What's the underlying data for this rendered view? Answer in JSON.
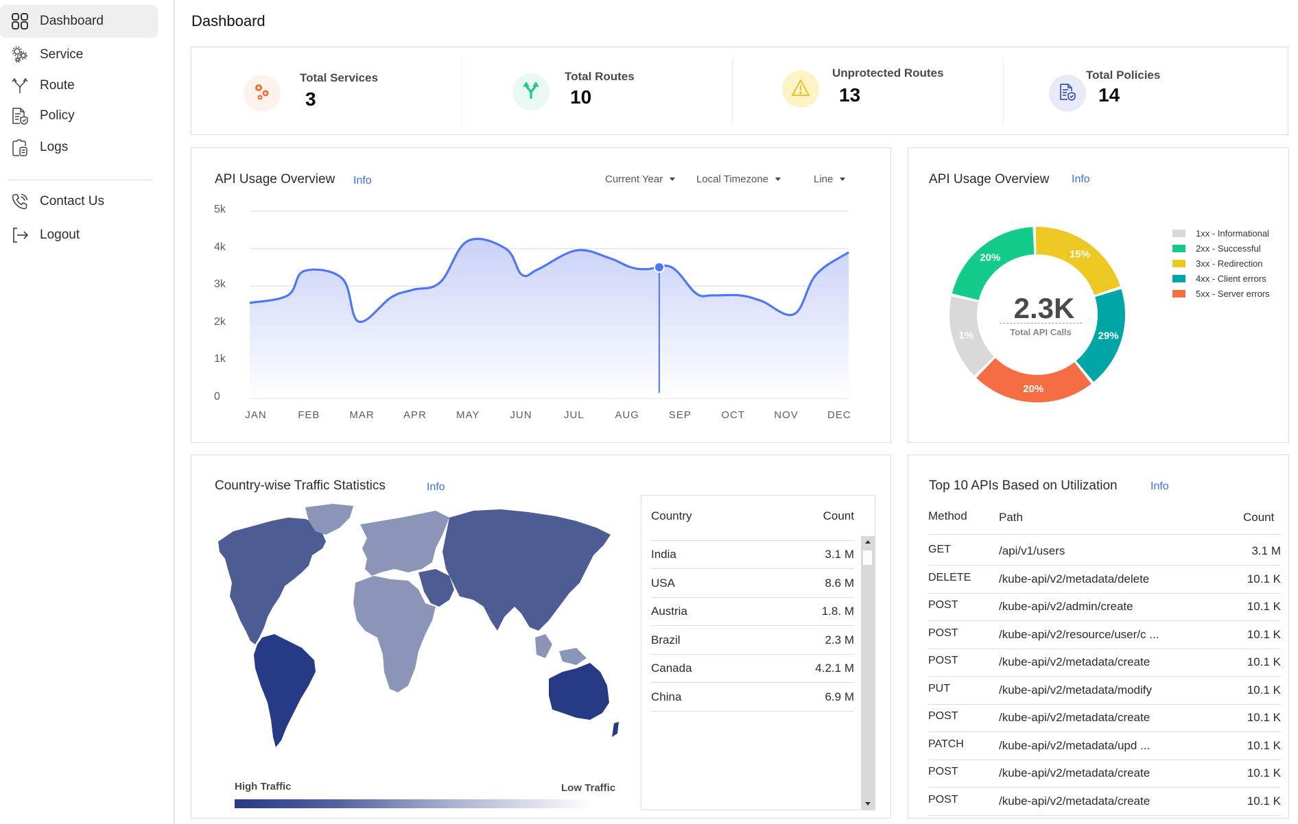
{
  "sidebar": {
    "items": [
      {
        "label": "Dashboard",
        "icon": "dashboard-grid-icon",
        "active": true
      },
      {
        "label": "Service",
        "icon": "gears-icon"
      },
      {
        "label": "Route",
        "icon": "route-split-icon"
      },
      {
        "label": "Policy",
        "icon": "policy-document-icon"
      },
      {
        "label": "Logs",
        "icon": "clipboard-icon"
      }
    ],
    "bottom_items": [
      {
        "label": "Contact Us",
        "icon": "phone-icon"
      },
      {
        "label": "Logout",
        "icon": "logout-icon"
      }
    ]
  },
  "header": {
    "title": "Dashboard"
  },
  "stats": [
    {
      "label": "Total Services",
      "value": "3",
      "icon": "gears-icon",
      "color": "#f26b3a",
      "bg": "#fff1ec"
    },
    {
      "label": "Total Routes",
      "value": "10",
      "icon": "route-split-icon",
      "color": "#1ec98a",
      "bg": "#e8f9f2"
    },
    {
      "label": "Unprotected Routes",
      "value": "13",
      "icon": "warning-icon",
      "color": "#e9c22b",
      "bg": "#fdf3c4"
    },
    {
      "label": "Total Policies",
      "value": "14",
      "icon": "policy-document-icon",
      "color": "#3d51b8",
      "bg": "#e8eaf8"
    }
  ],
  "usage_chart": {
    "title": "API Usage Overview",
    "info_label": "Info",
    "controls": [
      "Current Year",
      "Local Timezone",
      "Line"
    ]
  },
  "status_chart": {
    "title": "API Usage Overview",
    "info_label": "Info",
    "center_value": "2.3K",
    "center_label": "Total API Calls"
  },
  "traffic": {
    "title": "Country-wise Traffic Statistics",
    "info_label": "Info",
    "legend_high": "High Traffic",
    "legend_low": "Low Traffic",
    "table_headers": {
      "country": "Country",
      "count": "Count"
    },
    "rows": [
      {
        "country": "India",
        "count": "3.1 M"
      },
      {
        "country": "USA",
        "count": "8.6 M"
      },
      {
        "country": "Austria",
        "count": "1.8. M"
      },
      {
        "country": "Brazil",
        "count": "2.3 M"
      },
      {
        "country": "Canada",
        "count": "4.2.1 M"
      },
      {
        "country": "China",
        "count": "6.9 M"
      }
    ],
    "region_colors": {
      "high": "#263a86",
      "medium": "#4e5c94",
      "low": "#8a95b8"
    }
  },
  "top_apis": {
    "title": "Top 10 APIs Based on Utilization",
    "info_label": "Info",
    "headers": {
      "method": "Method",
      "path": "Path",
      "count": "Count"
    },
    "rows": [
      {
        "method": "GET",
        "path": "/api/v1/users",
        "count": "3.1 M"
      },
      {
        "method": "DELETE",
        "path": "/kube-api/v2/metadata/delete",
        "count": "10.1 K"
      },
      {
        "method": "POST",
        "path": "/kube-api/v2/admin/create",
        "count": "10.1 K"
      },
      {
        "method": "POST",
        "path": "/kube-api/v2/resource/user/c ...",
        "count": "10.1 K"
      },
      {
        "method": "POST",
        "path": "/kube-api/v2/metadata/create",
        "count": "10.1 K"
      },
      {
        "method": "PUT",
        "path": "/kube-api/v2/metadata/modify",
        "count": "10.1 K"
      },
      {
        "method": "POST",
        "path": "/kube-api/v2/metadata/create",
        "count": "10.1 K"
      },
      {
        "method": "PATCH",
        "path": "/kube-api/v2/metadata/upd ...",
        "count": "10.1 K"
      },
      {
        "method": "POST",
        "path": "/kube-api/v2/metadata/create",
        "count": "10.1 K"
      },
      {
        "method": "POST",
        "path": "/kube-api/v2/metadata/create",
        "count": "10.1 K"
      }
    ]
  },
  "chart_data": [
    {
      "type": "area",
      "title": "API Usage Overview",
      "categories": [
        "JAN",
        "FEB",
        "MAR",
        "APR",
        "MAY",
        "JUN",
        "JUL",
        "AUG",
        "SEP",
        "OCT",
        "NOV",
        "DEC"
      ],
      "x": [
        0,
        0.7,
        1,
        1.7,
        2,
        2.6,
        3,
        3.5,
        4,
        4.7,
        5,
        5.3,
        6,
        6.6,
        7,
        7.3,
        7.75,
        8.2,
        8.5,
        9,
        9.4,
        10,
        10.4,
        11
      ],
      "values": [
        2550,
        2750,
        3400,
        3200,
        2050,
        2700,
        2900,
        3100,
        4200,
        4000,
        3300,
        3450,
        3950,
        3750,
        3500,
        3450,
        3500,
        2800,
        2750,
        2750,
        2600,
        2250,
        3300,
        3900
      ],
      "yticks": [
        "0",
        "1k",
        "2k",
        "3k",
        "4k",
        "5k"
      ],
      "ylim": [
        0,
        5000
      ],
      "grid": true,
      "highlight": {
        "category": "SEP",
        "value": 3500
      },
      "line_color": "#4f76f6",
      "xlabel": "",
      "ylabel": ""
    },
    {
      "type": "pie",
      "title": "API Usage Overview",
      "categories": [
        "1xx - Informational",
        "2xx - Successful",
        "3xx - Redirection",
        "4xx - Client errors",
        "5xx - Server errors"
      ],
      "values": [
        1,
        20,
        15,
        29,
        20
      ],
      "labels": [
        "1%",
        "20%",
        "15%",
        "29%",
        "20%"
      ],
      "colors": [
        "#d9d9d9",
        "#13cc8a",
        "#edc823",
        "#00a6a6",
        "#f46d43"
      ],
      "legend": "right"
    }
  ]
}
